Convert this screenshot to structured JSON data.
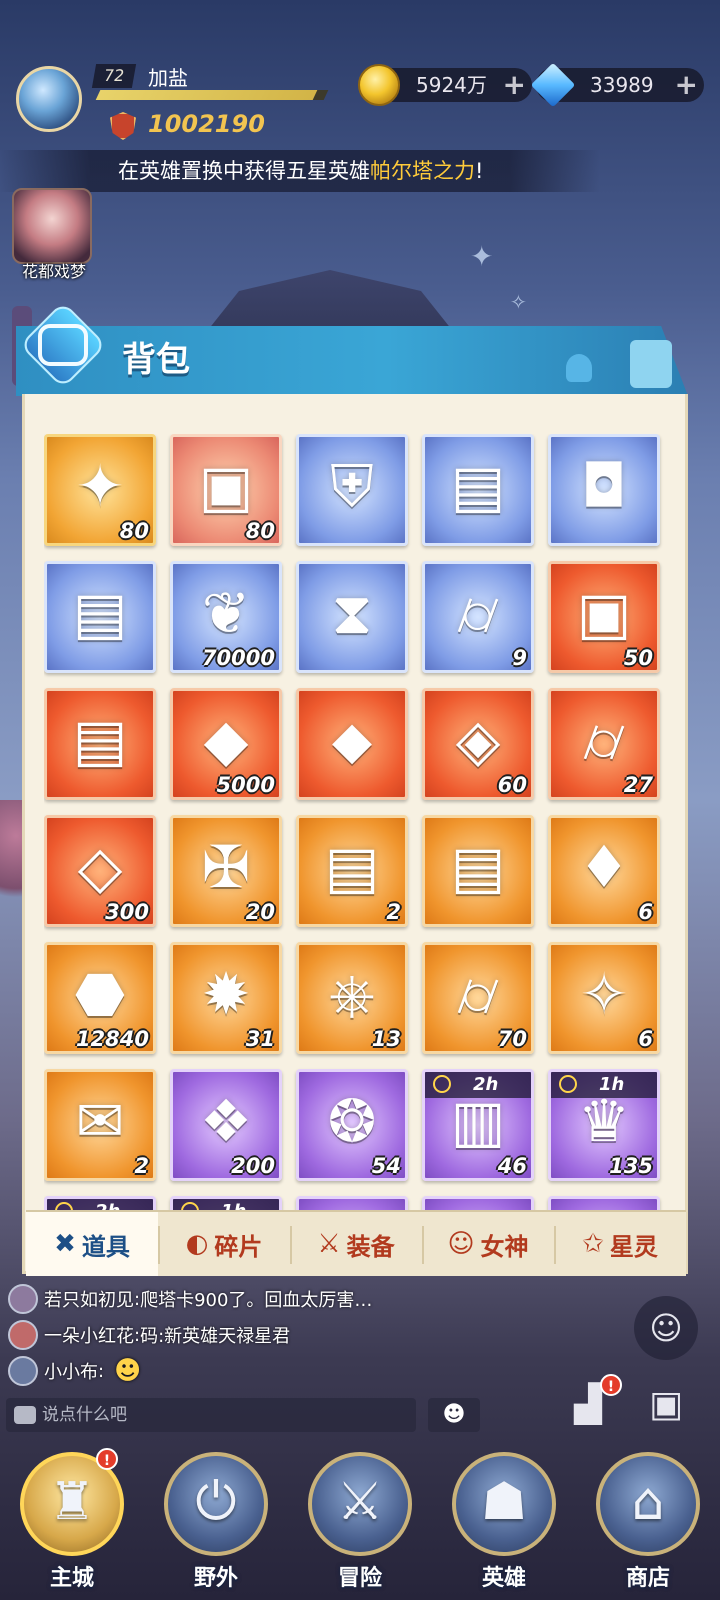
{
  "player": {
    "level": "72",
    "name": "加盐",
    "xp_fraction": 0.95,
    "power": "1002190"
  },
  "currency": {
    "gold": "5924万",
    "gems": "33989",
    "plus": "+"
  },
  "marquee": {
    "prefix": "在英雄置换中获得五星英雄",
    "hero": "帕尔塔之力",
    "suffix": "!"
  },
  "side_event": {
    "label": "花都戏梦"
  },
  "bag": {
    "title": "背包",
    "items": [
      {
        "color": "gold",
        "icon": "star-shuriken-icon",
        "glyph": "✦",
        "count": "80"
      },
      {
        "color": "pink",
        "icon": "crystal-cube-icon",
        "glyph": "▣",
        "count": "80"
      },
      {
        "color": "blue",
        "icon": "armor-icon",
        "glyph": "⛨",
        "count": ""
      },
      {
        "color": "blue",
        "icon": "gold-chest-icon",
        "glyph": "▤",
        "count": ""
      },
      {
        "color": "blue",
        "icon": "silver-chest-icon",
        "glyph": "◘",
        "count": ""
      },
      {
        "color": "blue",
        "icon": "gold-chest-icon",
        "glyph": "▤",
        "count": ""
      },
      {
        "color": "blue",
        "icon": "leaf-icon",
        "glyph": "❦",
        "count": "70000"
      },
      {
        "color": "blue",
        "icon": "hourglass-icon",
        "glyph": "⧗",
        "count": ""
      },
      {
        "color": "blue",
        "icon": "scroll-tube-icon",
        "glyph": "⌭",
        "count": "9"
      },
      {
        "color": "red",
        "icon": "crystal-cube-icon",
        "glyph": "▣",
        "count": "50"
      },
      {
        "color": "red",
        "icon": "gold-chest-icon",
        "glyph": "▤",
        "count": ""
      },
      {
        "color": "red",
        "icon": "dark-crystal-icon",
        "glyph": "◆",
        "count": "5000"
      },
      {
        "color": "red",
        "icon": "blue-crystal-icon",
        "glyph": "⬥",
        "count": ""
      },
      {
        "color": "red",
        "icon": "purple-gem-icon",
        "glyph": "◈",
        "count": "60"
      },
      {
        "color": "red",
        "icon": "scroll-tube-icon",
        "glyph": "⌭",
        "count": "27"
      },
      {
        "color": "red",
        "icon": "diamond-ore-icon",
        "glyph": "◇",
        "count": "300"
      },
      {
        "color": "orange",
        "icon": "hero-puzzle-icon",
        "glyph": "✠",
        "count": "20"
      },
      {
        "color": "orange",
        "icon": "chest-icon",
        "glyph": "▤",
        "count": "2"
      },
      {
        "color": "orange",
        "icon": "gold-chest-icon",
        "glyph": "▤",
        "count": ""
      },
      {
        "color": "orange",
        "icon": "card-icon",
        "glyph": "♦",
        "count": "6"
      },
      {
        "color": "orange",
        "icon": "ore-icon",
        "glyph": "⬣",
        "count": "12840"
      },
      {
        "color": "orange",
        "icon": "fire-wheel-icon",
        "glyph": "✹",
        "count": "31"
      },
      {
        "color": "orange",
        "icon": "ship-wheel-icon",
        "glyph": "⎈",
        "count": "13"
      },
      {
        "color": "orange",
        "icon": "scroll-tube-icon",
        "glyph": "⌭",
        "count": "70"
      },
      {
        "color": "orange",
        "icon": "gem-crest-icon",
        "glyph": "✧",
        "count": "6"
      },
      {
        "color": "orange",
        "icon": "scroll-icon",
        "glyph": "✉",
        "count": "2"
      },
      {
        "color": "purple",
        "icon": "armor-book-icon",
        "glyph": "❖",
        "count": "200"
      },
      {
        "color": "purple",
        "icon": "meat-icon",
        "glyph": "❂",
        "count": "54"
      },
      {
        "color": "purple",
        "icon": "treasure-box-icon",
        "glyph": "▥",
        "count": "46",
        "timer": "2h"
      },
      {
        "color": "purple",
        "icon": "treasure-bag-icon",
        "glyph": "♛",
        "count": "135",
        "timer": "1h"
      },
      {
        "color": "purple",
        "icon": "treasure-box-icon",
        "glyph": "▥",
        "count": "",
        "timer": "2h"
      },
      {
        "color": "purple",
        "icon": "treasure-bag-icon",
        "glyph": "♛",
        "count": "",
        "timer": "1h"
      },
      {
        "color": "purple",
        "icon": "item-icon",
        "glyph": "◼",
        "count": ""
      },
      {
        "color": "purple",
        "icon": "item-icon",
        "glyph": "◼",
        "count": ""
      },
      {
        "color": "purple",
        "icon": "item-icon",
        "glyph": "◼",
        "count": ""
      }
    ],
    "tabs": [
      {
        "label": "道具",
        "icon": "items-tab-icon",
        "glyph": "✖",
        "active": true
      },
      {
        "label": "碎片",
        "icon": "fragment-tab-icon",
        "glyph": "◐",
        "active": false
      },
      {
        "label": "装备",
        "icon": "equip-tab-icon",
        "glyph": "⚔",
        "active": false
      },
      {
        "label": "女神",
        "icon": "goddess-tab-icon",
        "glyph": "☺",
        "active": false
      },
      {
        "label": "星灵",
        "icon": "star-spirit-tab-icon",
        "glyph": "✩",
        "active": false
      }
    ]
  },
  "chat": {
    "messages": [
      {
        "user": "若只如初见",
        "text": "爬塔卡900了。回血太厉害…"
      },
      {
        "user": "一朵小红花",
        "text": "码:新英雄天禄星君"
      },
      {
        "user": "小小布",
        "text": ""
      }
    ],
    "separator": ":",
    "placeholder": "说点什么吧",
    "emoji": "☻"
  },
  "badges": {
    "alert": "!"
  },
  "nav": [
    {
      "label": "主城",
      "icon": "castle-icon",
      "glyph": "♜",
      "active": true,
      "alert": true
    },
    {
      "label": "野外",
      "icon": "wild-icon",
      "glyph": "⏻",
      "active": false,
      "alert": false
    },
    {
      "label": "冒险",
      "icon": "sword-icon",
      "glyph": "⚔",
      "active": false,
      "alert": false
    },
    {
      "label": "英雄",
      "icon": "helmet-icon",
      "glyph": "☗",
      "active": false,
      "alert": false
    },
    {
      "label": "商店",
      "icon": "shop-icon",
      "glyph": "⌂",
      "active": false,
      "alert": false
    }
  ]
}
